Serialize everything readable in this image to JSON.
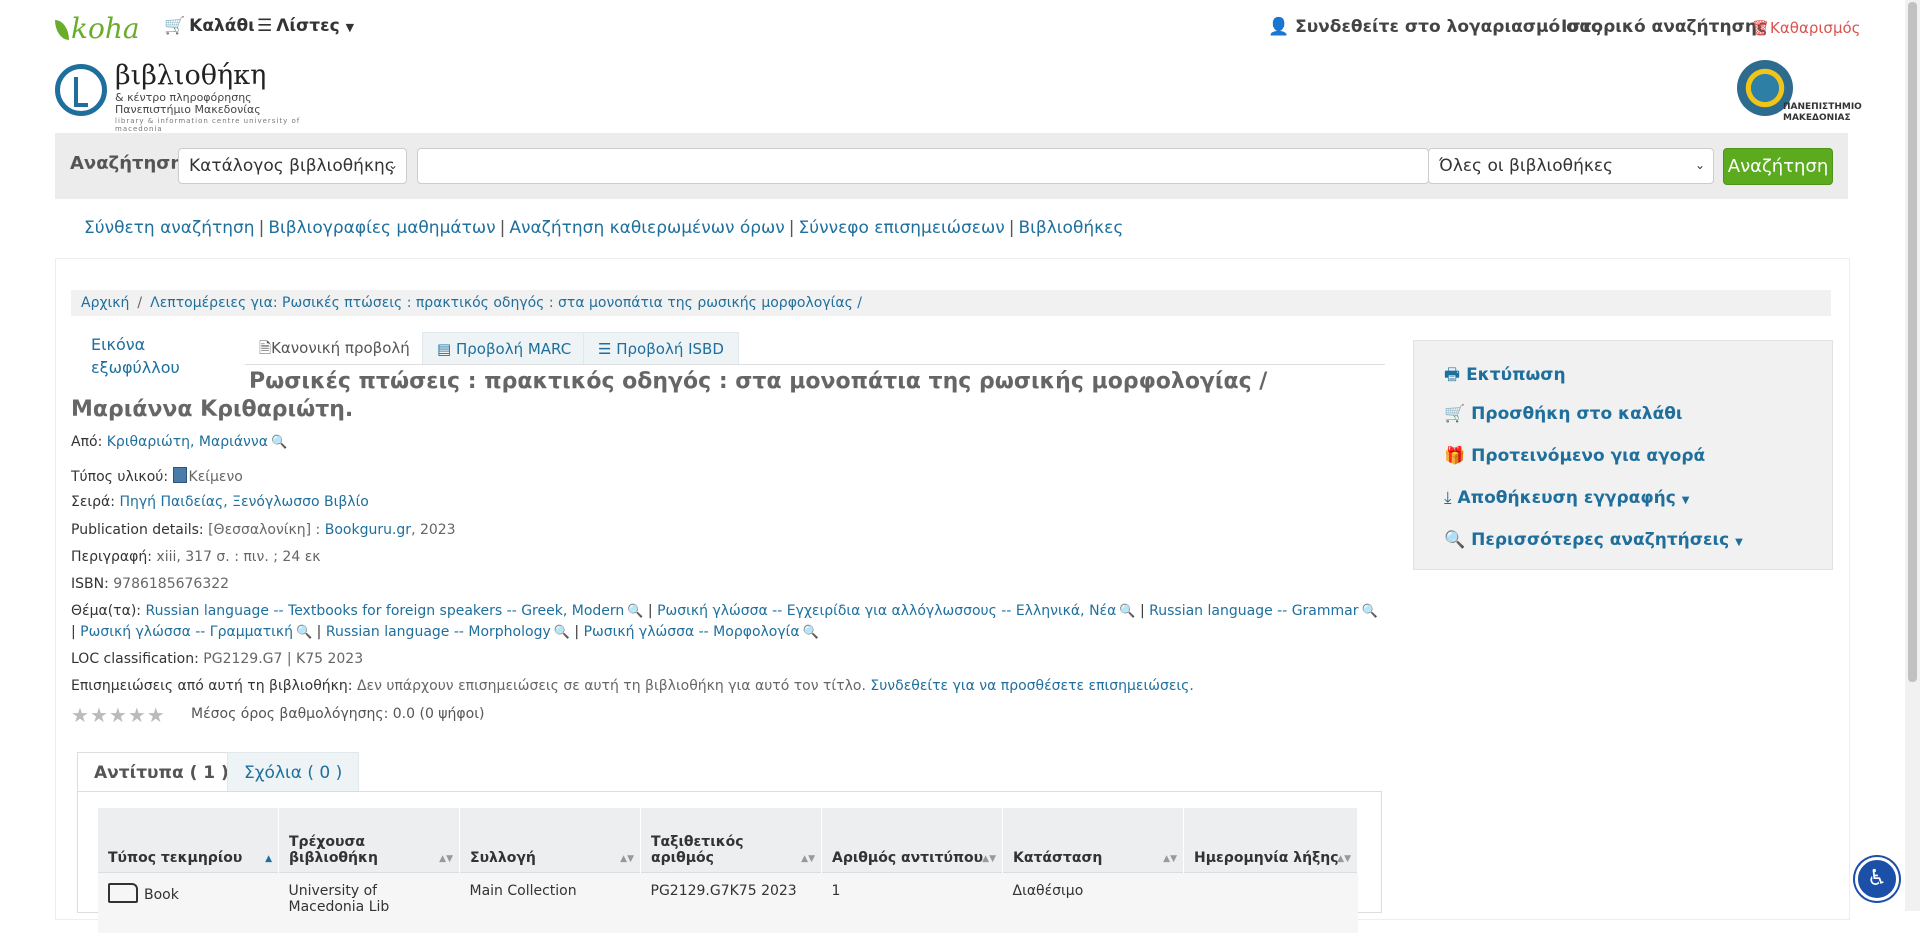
{
  "topbar": {
    "logo": "koha",
    "cart": "Καλάθι",
    "lists": "Λίστες",
    "login": "Συνδεθείτε στο λογαριασμό σας",
    "history": "Ιστορικό αναζήτησης",
    "clear": "Καθαρισμός"
  },
  "library": {
    "name": "βιβλιοθήκη",
    "subtitle": "& κέντρο πληροφόρησης\nΠανεπιστήμιο Μακεδονίας",
    "english": "library & information centre university of macedonia",
    "university": "ΠΑΝΕΠΙΣΤΗΜΙΟ ΜΑΚΕΔΟΝΙΑΣ"
  },
  "search": {
    "label": "Αναζήτηση",
    "type_selected": "Κατάλογος βιβλιοθήκης",
    "query": "",
    "library_selected": "Όλες οι βιβλιοθήκες",
    "button": "Αναζήτηση"
  },
  "moresearches": [
    "Σύνθετη αναζήτηση",
    "Βιβλιογραφίες μαθημάτων",
    "Αναζήτηση καθιερωμένων όρων",
    "Σύννεφο επισημειώσεων",
    "Βιβλιοθήκες"
  ],
  "breadcrumb": {
    "home": "Αρχική",
    "current": "Λεπτομέρειες για: Ρωσικές πτώσεις : πρακτικός οδηγός : στα μονοπάτια της ρωσικής μορφολογίας /"
  },
  "cover_alt": "Εικόνα εξωφύλλου",
  "views": {
    "normal": "Κανονική προβολή",
    "marc": "Προβολή MARC",
    "isbd": "Προβολή ISBD"
  },
  "record": {
    "title": "Ρωσικές πτώσεις : πρακτικός οδηγός : στα μονοπάτια της ρωσικής μορφολογίας / Μαριάννα Κριθαριώτη.",
    "author_label": "Από:",
    "author": "Κριθαριώτη, Μαριάννα",
    "type_label": "Τύπος υλικού:",
    "type": "Κείμενο",
    "series_label": "Σειρά:",
    "series": "Πηγή Παιδείας, Ξενόγλωσσο Βιβλίο",
    "pub_label": "Publication details:",
    "pub_place": "[Θεσσαλονίκη] :",
    "publisher": "Bookguru.gr",
    "pub_year": ", 2023",
    "desc_label": "Περιγραφή:",
    "desc": "xiii, 317 σ. : πιν. ; 24 εκ",
    "isbn_label": "ISBN:",
    "isbn": "9786185676322",
    "subjects_label": "Θέμα(τα):",
    "subjects": [
      "Russian language -- Textbooks for foreign speakers -- Greek, Modern",
      "Ρωσική γλώσσα -- Εγχειρίδια για αλλόγλωσσους -- Ελληνικά, Νέα",
      "Russian language -- Grammar",
      "Ρωσική γλώσσα -- Γραμματική",
      "Russian language -- Morphology",
      "Ρωσική γλώσσα -- Μορφολογία"
    ],
    "loc_label": "LOC classification:",
    "loc": "PG2129.G7 | K75 2023",
    "tags_label": "Επισημειώσεις από αυτή τη βιβλιοθήκη:",
    "tags_none": "Δεν υπάρχουν επισημειώσεις σε αυτή τη βιβλιοθήκη για αυτό τον τίτλο.",
    "tags_login": "Συνδεθείτε για να προσθέσετε επισημειώσεις.",
    "rating": "Μέσος όρος βαθμολόγησης: 0.0 (0 ψήφοι)"
  },
  "holdings_tabs": {
    "copies": "Αντίτυπα ( 1 )",
    "comments": "Σχόλια ( 0 )"
  },
  "table": {
    "headers": [
      "Τύπος τεκμηρίου",
      "Τρέχουσα βιβλιοθήκη",
      "Συλλογή",
      "Ταξιθετικός αριθμός",
      "Αριθμός αντιτύπου",
      "Κατάσταση",
      "Ημερομηνία λήξης"
    ],
    "row": {
      "type": "Book",
      "library": "University of Macedonia Lib",
      "collection": "Main Collection",
      "callnumber": "PG2129.G7K75 2023",
      "copy": "1",
      "status": "Διαθέσιμο",
      "due": ""
    }
  },
  "sidebar": {
    "print": "Εκτύπωση",
    "addcart": "Προσθήκη στο καλάθι",
    "suggest": "Προτεινόμενο για αγορά",
    "save": "Αποθήκευση εγγραφής",
    "more": "Περισσότερες αναζητήσεις"
  },
  "accessibility_icon": "accessibility-icon"
}
